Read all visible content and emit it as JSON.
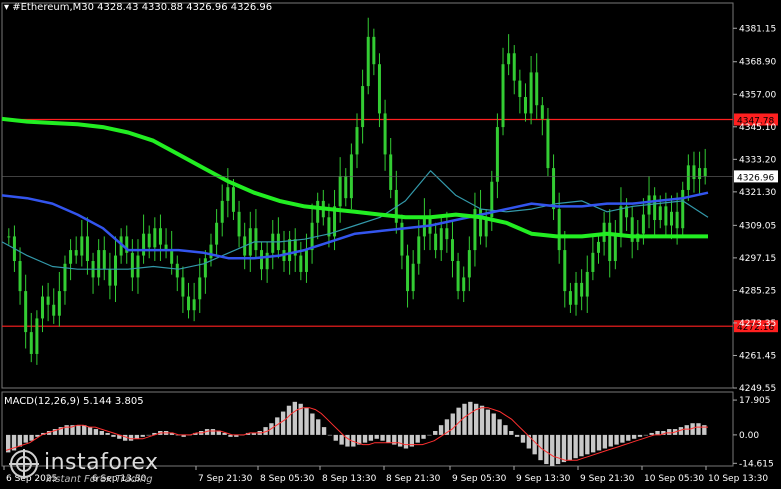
{
  "header": {
    "symbol_line": "#Ethereum,M30  4328.43 4330.88 4326.96 4326.96",
    "macd_line": "MACD(12,26,9) 5.144 3.805"
  },
  "logo": {
    "brand": "instaforex",
    "tagline": "Instant Forex Trading"
  },
  "colors": {
    "background": "#000000",
    "candles": "#33cc33",
    "ma_fast": "#3399aa",
    "ma_mid": "#3355ee",
    "ma_slow": "#22ee22",
    "levels": "#ff2020",
    "macd_hist": "#c8c8c8",
    "macd_signal": "#ff3030",
    "price_tag": "#ffffff"
  },
  "chart_data": {
    "type": "candlestick",
    "symbol": "#Ethereum",
    "timeframe": "M30",
    "ylim": [
      4249.55,
      4386
    ],
    "y_ticks": [
      "4381.15",
      "4368.90",
      "4357.00",
      "4345.10",
      "4333.20",
      "4321.30",
      "4309.05",
      "4297.15",
      "4285.25",
      "4273.35",
      "4261.45",
      "4249.55"
    ],
    "x_ticks": [
      "6 Sep 2025",
      "6 Sep 13:30",
      "7 Sep 21:30",
      "8 Sep 05:30",
      "8 Sep 13:30",
      "8 Sep 21:30",
      "9 Sep 05:30",
      "9 Sep 13:30",
      "9 Sep 21:30",
      "10 Sep 05:30",
      "10 Sep 13:30"
    ],
    "levels": [
      {
        "value": 4347.78,
        "label": "4347.78"
      },
      {
        "value": 4272.16,
        "label": "4272.16"
      }
    ],
    "current_price": {
      "value": 4326.96,
      "label": "4326.96"
    },
    "closes": [
      4305,
      4296,
      4285,
      4270,
      4262,
      4275,
      4283,
      4280,
      4276,
      4285,
      4295,
      4300,
      4298,
      4305,
      4296,
      4290,
      4300,
      4293,
      4287,
      4298,
      4305,
      4299,
      4290,
      4298,
      4306,
      4301,
      4308,
      4302,
      4300,
      4295,
      4290,
      4283,
      4278,
      4282,
      4290,
      4297,
      4302,
      4310,
      4318,
      4323,
      4314,
      4305,
      4298,
      4308,
      4300,
      4293,
      4299,
      4306,
      4300,
      4296,
      4304,
      4298,
      4292,
      4300,
      4310,
      4318,
      4312,
      4305,
      4316,
      4327,
      4319,
      4335,
      4345,
      4360,
      4378,
      4368,
      4350,
      4335,
      4322,
      4310,
      4298,
      4285,
      4295,
      4305,
      4312,
      4306,
      4300,
      4308,
      4304,
      4296,
      4285,
      4290,
      4300,
      4315,
      4305,
      4312,
      4325,
      4345,
      4368,
      4372,
      4362,
      4356,
      4350,
      4365,
      4353,
      4348,
      4330,
      4315,
      4300,
      4285,
      4280,
      4288,
      4283,
      4292,
      4299,
      4303,
      4310,
      4296,
      4305,
      4316,
      4312,
      4303,
      4306,
      4313,
      4320,
      4311,
      4316,
      4309,
      4314,
      4308,
      4322,
      4331,
      4326,
      4330,
      4327
    ],
    "ma_slow": {
      "name": "",
      "values": [
        4348,
        4347,
        4346.5,
        4346,
        4345,
        4343,
        4340,
        4335,
        4330,
        4325,
        4321,
        4318,
        4316,
        4315,
        4314,
        4313,
        4312,
        4312,
        4313,
        4312,
        4310,
        4306,
        4305,
        4305,
        4306,
        4305,
        4305,
        4305,
        4305
      ]
    },
    "ma_mid": {
      "name": "",
      "values": [
        4320,
        4319,
        4317,
        4313,
        4308,
        4300,
        4300,
        4300,
        4299,
        4297,
        4297,
        4298,
        4300,
        4303,
        4306,
        4307,
        4308,
        4309,
        4311,
        4313,
        4315,
        4317,
        4316,
        4316,
        4317,
        4317,
        4318,
        4319,
        4321
      ]
    },
    "ma_fast": {
      "name": "",
      "values": [
        4303,
        4298,
        4294,
        4293,
        4293,
        4293,
        4294,
        4293,
        4295,
        4299,
        4303,
        4303,
        4304,
        4306,
        4309,
        4312,
        4318,
        4329,
        4320,
        4315,
        4314,
        4315,
        4317,
        4318,
        4314,
        4316,
        4317,
        4318,
        4312
      ]
    },
    "macd": {
      "ylim": [
        -16,
        20
      ],
      "y_ticks": [
        "17.905",
        "0.00",
        "-14.615"
      ],
      "histogram": [
        -9,
        -8,
        -6,
        -4,
        -3,
        -1,
        1,
        2,
        3,
        4,
        5,
        5,
        5,
        5,
        4,
        3,
        2,
        1,
        -1,
        -2,
        -3,
        -3,
        -2,
        -1,
        0,
        1,
        2,
        2,
        1,
        0,
        -1,
        0,
        1,
        2,
        3,
        3,
        2,
        1,
        -1,
        -1,
        0,
        1,
        1,
        2,
        4,
        6,
        9,
        12,
        15,
        17,
        16,
        14,
        11,
        8,
        4,
        0,
        -3,
        -5,
        -6,
        -6,
        -5,
        -4,
        -3,
        -2,
        -3,
        -4,
        -5,
        -6,
        -7,
        -6,
        -4,
        -2,
        0,
        2,
        5,
        8,
        11,
        14,
        16,
        17,
        16,
        15,
        13,
        11,
        8,
        5,
        2,
        -1,
        -4,
        -7,
        -10,
        -13,
        -15,
        -16,
        -15,
        -14,
        -13,
        -12,
        -11,
        -10,
        -9,
        -8,
        -7,
        -6,
        -5,
        -4,
        -3,
        -2,
        -1,
        0,
        1,
        2,
        2,
        3,
        3,
        4,
        5,
        6,
        6,
        5
      ],
      "signal": [
        -8,
        -7,
        -6,
        -5,
        -4,
        -2,
        0,
        1,
        2,
        3,
        4,
        4,
        5,
        5,
        4,
        4,
        3,
        2,
        1,
        0,
        -1,
        -2,
        -2,
        -2,
        -1,
        0,
        1,
        1,
        1,
        0,
        0,
        0,
        1,
        1,
        2,
        2,
        2,
        1,
        0,
        0,
        0,
        1,
        1,
        1,
        2,
        4,
        6,
        8,
        11,
        13,
        14,
        14,
        13,
        11,
        8,
        5,
        2,
        -1,
        -3,
        -4,
        -5,
        -5,
        -4,
        -4,
        -4,
        -4,
        -4,
        -5,
        -5,
        -5,
        -5,
        -4,
        -3,
        -1,
        1,
        3,
        6,
        9,
        11,
        13,
        14,
        14,
        13,
        12,
        10,
        8,
        5,
        2,
        -1,
        -4,
        -7,
        -9,
        -11,
        -12,
        -13,
        -13,
        -13,
        -12,
        -11,
        -10,
        -9,
        -8,
        -7,
        -6,
        -5,
        -4,
        -3,
        -2,
        -1,
        0,
        0,
        1,
        1,
        2,
        3,
        3,
        4,
        4,
        4
      ]
    }
  }
}
